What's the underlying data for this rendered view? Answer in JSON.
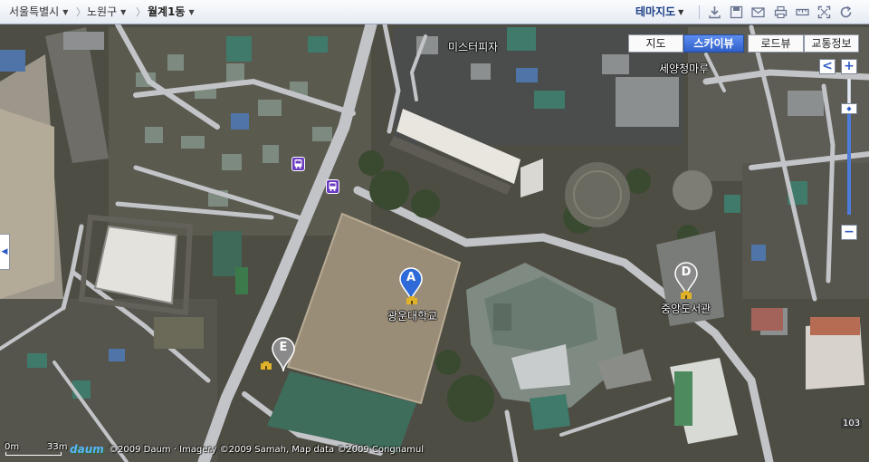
{
  "breadcrumb": {
    "city": "서울특별시",
    "district": "노원구",
    "neighborhood": "월계1동"
  },
  "theme_map": "테마지도",
  "toolbar_icons": [
    "download-icon",
    "save-icon",
    "mail-icon",
    "print-icon",
    "ruler-icon",
    "fullscreen-icon",
    "refresh-icon"
  ],
  "view_tabs": [
    "지도",
    "스카이뷰",
    "로드뷰",
    "교통정보"
  ],
  "active_tab": "스카이뷰",
  "zoom": {
    "in": "+",
    "out": "−",
    "prev": "<",
    "level": 0.22
  },
  "places": [
    {
      "name": "미스터피자"
    },
    {
      "name": "세양청마루"
    },
    {
      "name": "광운대학교"
    },
    {
      "name": "중앙도서관"
    }
  ],
  "markers": [
    {
      "letter": "A",
      "color": "#2f6bd8"
    },
    {
      "letter": "D",
      "color": "#8a8a8a"
    },
    {
      "letter": "E",
      "color": "#8a8a8a"
    }
  ],
  "scale": {
    "start": "0m",
    "end": "33m"
  },
  "logo": "daum",
  "copyright": "©2009 Daum · Imagery ©2009 Samah, Map data ©2009 Congnamul",
  "side_label": "103",
  "colors": {
    "tab_active": "#3a6fdc",
    "road": "#c2c4c8",
    "brand": "#1d3f86"
  }
}
